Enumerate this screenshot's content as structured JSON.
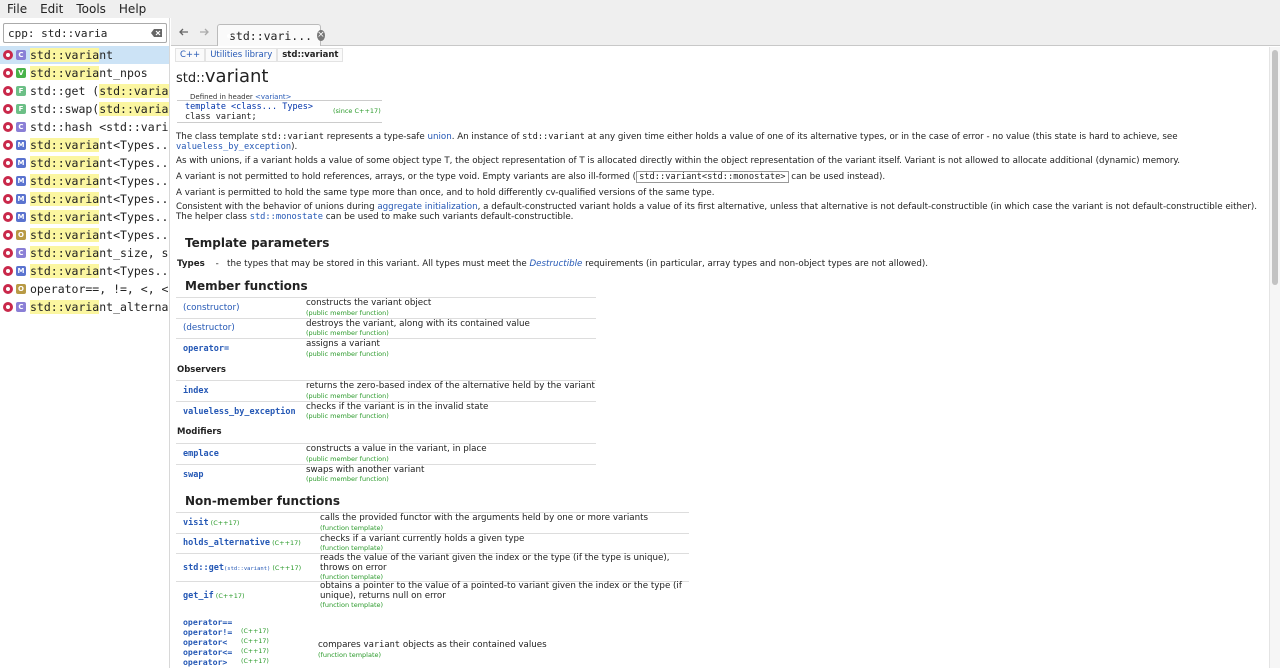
{
  "menubar": {
    "items": [
      "File",
      "Edit",
      "Tools",
      "Help"
    ]
  },
  "sidebar": {
    "search_value": "cpp: std::varia",
    "results": [
      {
        "kind": "C",
        "kind_color": "#8a7fd6",
        "pre": "std::varia",
        "post": "nt",
        "hl": "std::varia",
        "selected": true
      },
      {
        "kind": "V",
        "kind_color": "#49b34a",
        "text": "std::variant_npos"
      },
      {
        "kind": "F",
        "kind_color": "#6cbf86",
        "text": "std::get (std::varia..."
      },
      {
        "kind": "F",
        "kind_color": "#6cbf86",
        "text": "std::swap(std::varia..."
      },
      {
        "kind": "C",
        "kind_color": "#8a7fd6",
        "text": "std::hash <std::vari..."
      },
      {
        "kind": "M",
        "kind_color": "#5a73cf",
        "text": "std::variant<Types..."
      },
      {
        "kind": "M",
        "kind_color": "#5a73cf",
        "text": "std::variant<Types..."
      },
      {
        "kind": "M",
        "kind_color": "#5a73cf",
        "text": "std::variant<Types..."
      },
      {
        "kind": "M",
        "kind_color": "#5a73cf",
        "text": "std::variant<Types..."
      },
      {
        "kind": "M",
        "kind_color": "#5a73cf",
        "text": "std::variant<Types..."
      },
      {
        "kind": "O",
        "kind_color": "#b89a45",
        "text": "std::variant<Types..."
      },
      {
        "kind": "C",
        "kind_color": "#8a7fd6",
        "text": "std::variant_size, s..."
      },
      {
        "kind": "M",
        "kind_color": "#5a73cf",
        "text": "std::variant<Types..."
      },
      {
        "kind": "O",
        "kind_color": "#b89a45",
        "text": "operator==, !=, <, <..."
      },
      {
        "kind": "C",
        "kind_color": "#8a7fd6",
        "text": "std::variant_alterna..."
      }
    ]
  },
  "tabbar": {
    "tab_label": "std::vari..."
  },
  "doc": {
    "breadcrumb": [
      "C++",
      "Utilities library",
      "std::variant"
    ],
    "title_ns": "std::",
    "title_name": "variant",
    "defined_in_label": "Defined in header",
    "defined_in_header": "<variant>",
    "decl_line1": "template <class... Types>",
    "decl_line2": "class variant;",
    "decl_since": "(since C++17)",
    "p1_a": "The class template",
    "p1_b": "std::variant",
    "p1_c": "represents a type-safe",
    "p1_d": "union",
    "p1_e": ". An instance of",
    "p1_f": "std::variant",
    "p1_g": "at any given time either holds a value of one of its alternative types, or in the case of error - no value (this state is hard to achieve, see",
    "p1_h": "valueless_by_exception",
    "p1_i": ").",
    "p2": "As with unions, if a variant holds a value of some object type T, the object representation of T is allocated directly within the object representation of the variant itself. Variant is not allowed to allocate additional (dynamic) memory.",
    "p3_a": "A variant is not permitted to hold references, arrays, or the type void. Empty variants are also ill-formed (",
    "p3_b": "std::variant<std::monostate>",
    "p3_c": "can be used instead).",
    "p4": "A variant is permitted to hold the same type more than once, and to hold differently cv-qualified versions of the same type.",
    "p5_a": "Consistent with the behavior of unions during",
    "p5_b": "aggregate initialization",
    "p5_c": ", a default-constructed variant holds a value of its first alternative, unless that alternative is not default-constructible (in which case the variant is not default-constructible either).",
    "p6_a": "The helper class",
    "p6_b": "std::monostate",
    "p6_c": "can be used to make such variants default-constructible.",
    "h_template_params": "Template parameters",
    "types_name": "Types",
    "types_dash": "-",
    "types_a": "the types that may be stored in this variant. All types must meet the",
    "types_b": "Destructible",
    "types_c": "requirements (in particular, array types and non-object types are not allowed).",
    "h_member_functions": "Member functions",
    "h_observers": "Observers",
    "h_modifiers": "Modifiers",
    "h_nonmember": "Non-member functions",
    "member_fns": [
      {
        "name": "(constructor)",
        "desc": "constructs the variant object",
        "kind": "(public member function)"
      },
      {
        "name": "(destructor)",
        "desc": "destroys the variant, along with its contained value",
        "kind": "(public member function)"
      },
      {
        "name": "operator=",
        "desc": "assigns a variant",
        "kind": "(public member function)"
      }
    ],
    "observers": [
      {
        "name": "index",
        "desc": "returns the zero-based index of the alternative held by the variant",
        "kind": "(public member function)"
      },
      {
        "name": "valueless_by_exception",
        "desc": "checks if the variant is in the invalid state",
        "kind": "(public member function)"
      }
    ],
    "modifiers": [
      {
        "name": "emplace",
        "desc": "constructs a value in the variant, in place",
        "kind": "(public member function)"
      },
      {
        "name": "swap",
        "desc": "swaps with another variant",
        "kind": "(public member function)"
      }
    ],
    "nonmember": [
      {
        "name": "visit",
        "ver": "(C++17)",
        "desc": "calls the provided functor with the arguments held by one or more variants",
        "kind": "(function template)"
      },
      {
        "name": "holds_alternative",
        "ver": "(C++17)",
        "desc": "checks if a variant currently holds a given type",
        "kind": "(function template)"
      },
      {
        "name": "std::get",
        "small": "(std::variant)",
        "ver": "(C++17)",
        "desc": "reads the value of the variant given the index or the type (if the type is unique), throws on error",
        "kind": "(function template)"
      },
      {
        "name": "get_if",
        "ver": "(C++17)",
        "desc": "obtains a pointer to the value of a pointed-to variant given the index or the type (if unique), returns null on error",
        "kind": "(function template)"
      }
    ],
    "ops": [
      "operator==",
      "operator!=",
      "operator<",
      "operator<=",
      "operator>"
    ],
    "ops_ver": "(C++17)",
    "ops_desc_a": "compares",
    "ops_desc_b": "variant",
    "ops_desc_c": "objects as their contained values",
    "ops_kind": "(function template)"
  }
}
